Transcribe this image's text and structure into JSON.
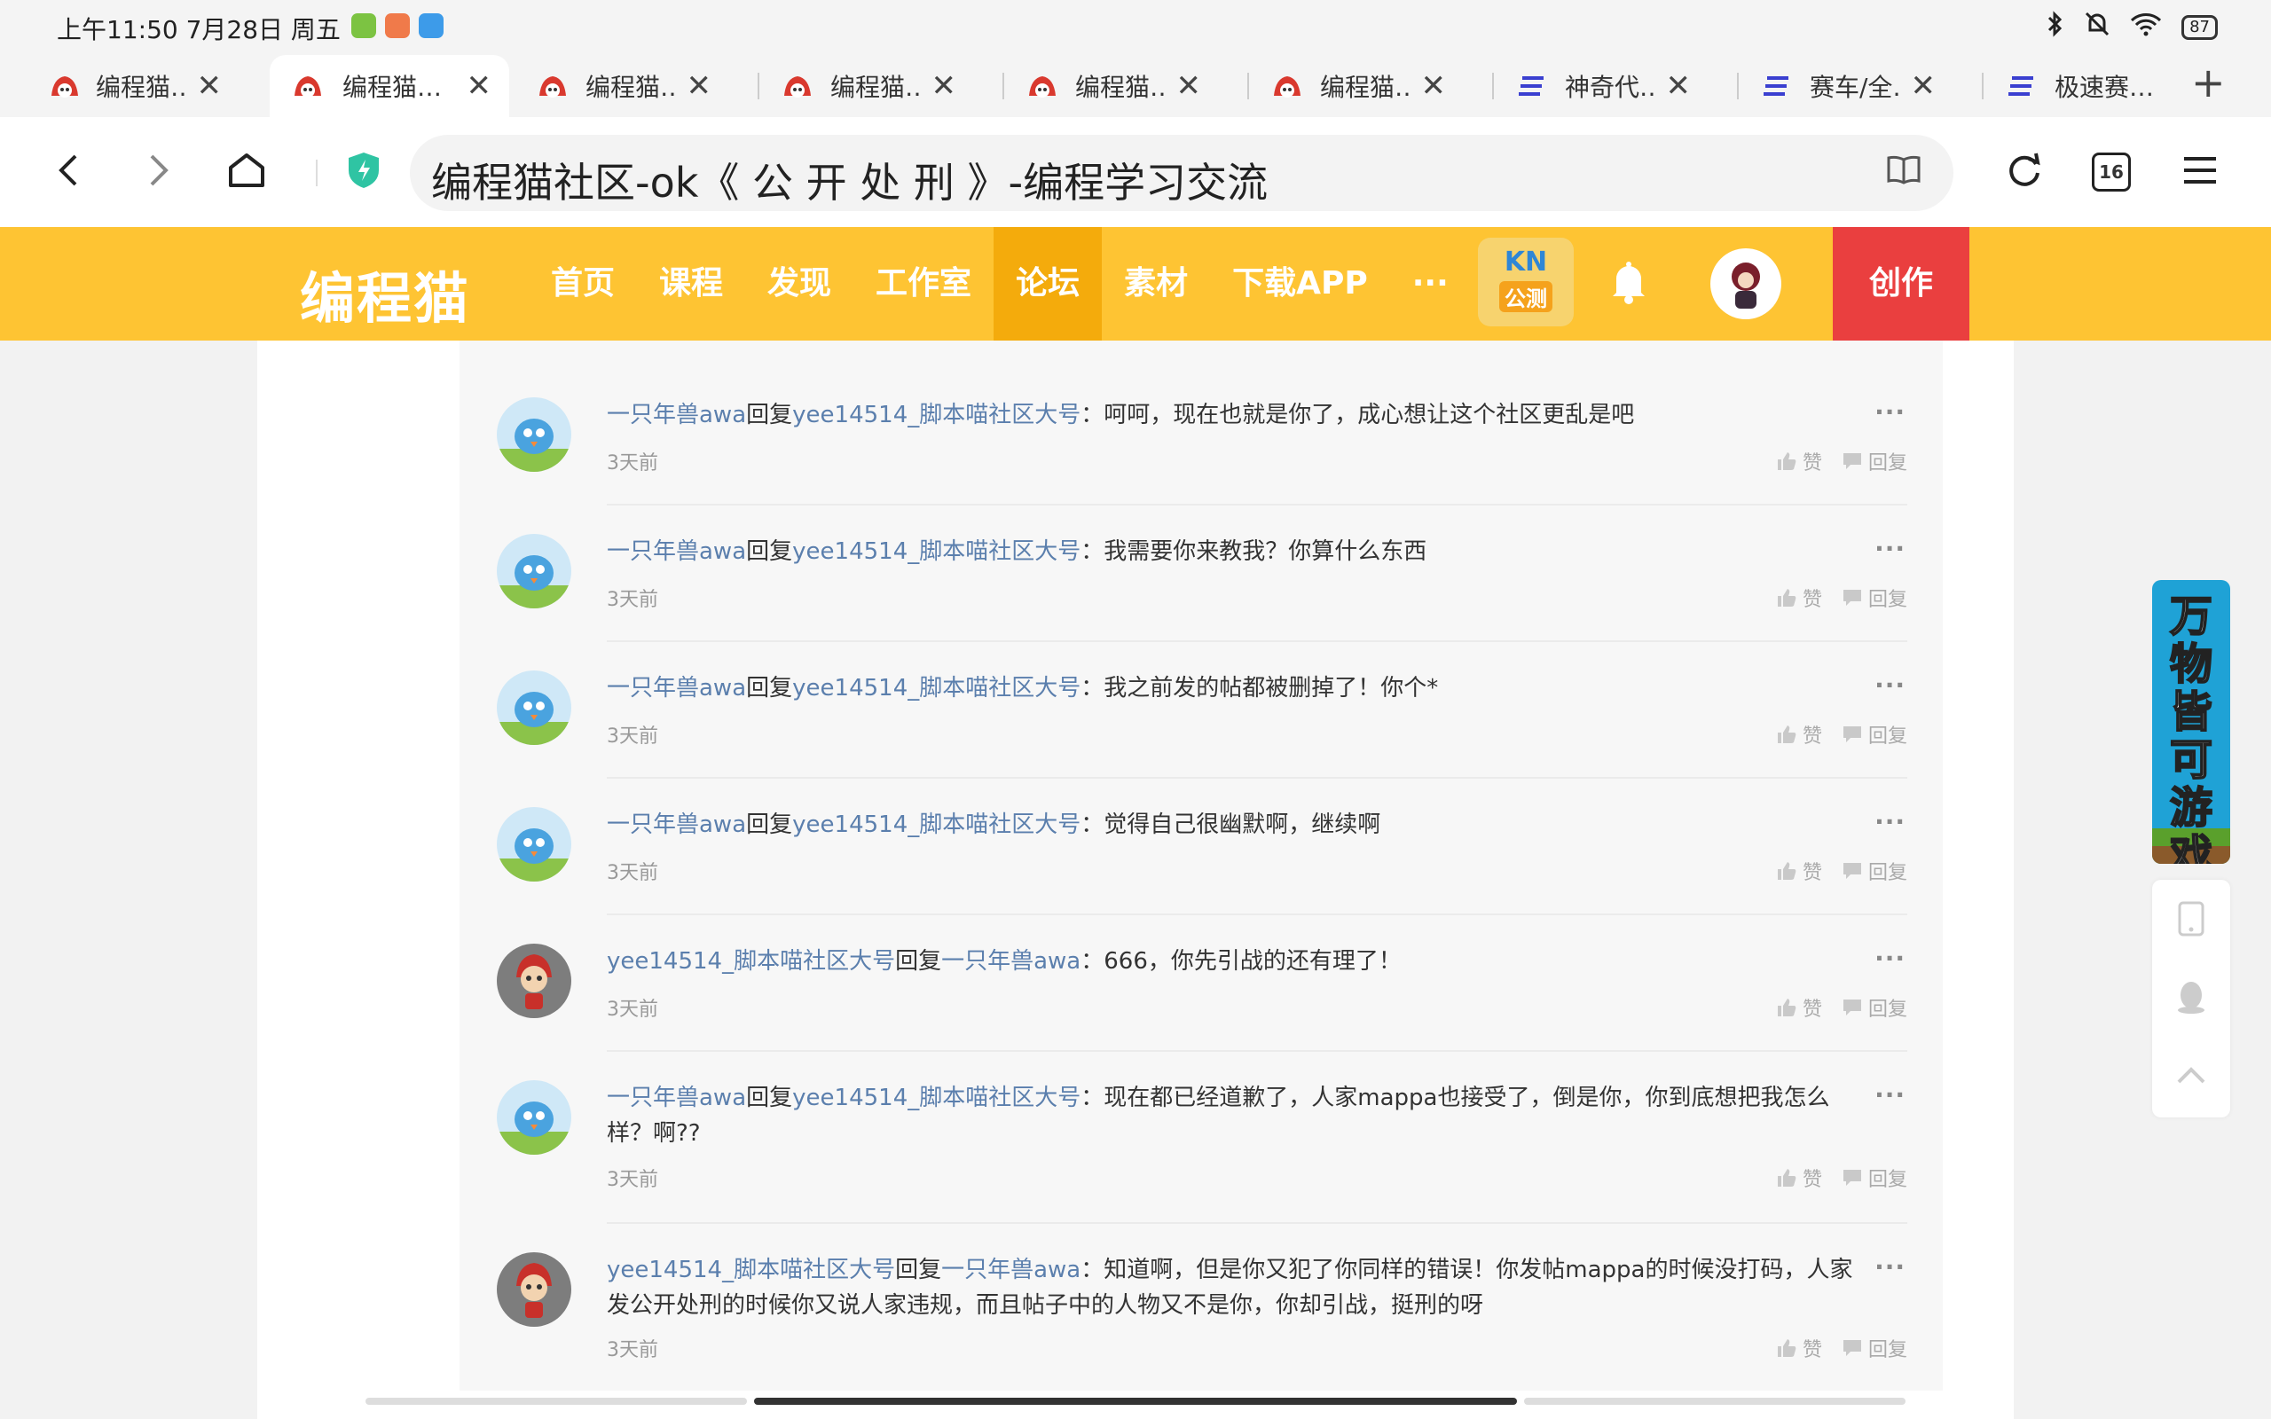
{
  "status_bar": {
    "time": "上午11:50 7月28日 周五",
    "battery": "87"
  },
  "tabs": [
    {
      "label": "编程猫…",
      "icon": "codemao-icon"
    },
    {
      "label": "编程猫…",
      "icon": "codemao-icon",
      "active": true
    },
    {
      "label": "编程猫…",
      "icon": "codemao-icon"
    },
    {
      "label": "编程猫…",
      "icon": "codemao-icon"
    },
    {
      "label": "编程猫…",
      "icon": "codemao-icon"
    },
    {
      "label": "编程猫…",
      "icon": "codemao-icon"
    },
    {
      "label": "神奇代…",
      "icon": "doc-icon"
    },
    {
      "label": "赛车/全…",
      "icon": "doc-icon"
    },
    {
      "label": "极速赛…",
      "icon": "doc-icon"
    }
  ],
  "address_bar": {
    "url_title": "编程猫社区-ok《 公 开 处 刑 》-编程学习交流",
    "tab_count": "16"
  },
  "site_header": {
    "logo": "编程猫",
    "nav": [
      "首页",
      "课程",
      "发现",
      "工作室",
      "论坛",
      "素材",
      "下载APP",
      "···"
    ],
    "active_nav": "论坛",
    "kn_top": "KN",
    "kn_bottom": "公测",
    "create": "创作",
    "brand_color": "#fec433",
    "create_color": "#ea3f3f"
  },
  "comments": [
    {
      "user": "一只年兽awa",
      "reply_word": "回复",
      "target": "yee14514_脚本喵社区大号",
      "text": "：呵呵，现在也就是你了，成心想让这个社区更乱是吧",
      "time": "3天前",
      "avatar": "bird-avatar"
    },
    {
      "user": "一只年兽awa",
      "reply_word": "回复",
      "target": "yee14514_脚本喵社区大号",
      "text": "：我需要你来教我？你算什么东西",
      "time": "3天前",
      "avatar": "bird-avatar"
    },
    {
      "user": "一只年兽awa",
      "reply_word": "回复",
      "target": "yee14514_脚本喵社区大号",
      "text": "：我之前发的帖都被删掉了！你个*",
      "time": "3天前",
      "avatar": "bird-avatar"
    },
    {
      "user": "一只年兽awa",
      "reply_word": "回复",
      "target": "yee14514_脚本喵社区大号",
      "text": "：觉得自己很幽默啊，继续啊",
      "time": "3天前",
      "avatar": "bird-avatar"
    },
    {
      "user": "yee14514_脚本喵社区大号",
      "reply_word": "回复",
      "target": "一只年兽awa",
      "text": "：666，你先引战的还有理了！",
      "time": "3天前",
      "avatar": "cat-avatar"
    },
    {
      "user": "一只年兽awa",
      "reply_word": "回复",
      "target": "yee14514_脚本喵社区大号",
      "text": "：现在都已经道歉了，人家mappa也接受了，倒是你，你到底想把我怎么样？啊??",
      "time": "3天前",
      "avatar": "bird-avatar"
    },
    {
      "user": "yee14514_脚本喵社区大号",
      "reply_word": "回复",
      "target": "一只年兽awa",
      "text": "：知道啊，但是你又犯了你同样的错误！你发帖mappa的时候没打码，人家发公开处刑的时候你又说人家违规，而且帖子中的人物又不是你，你却引战，挺刑的呀",
      "time": "3天前",
      "avatar": "cat-avatar"
    }
  ],
  "comment_actions": {
    "like": "赞",
    "reply": "回复",
    "more": "···"
  },
  "promo": {
    "text": "万物皆可游戏"
  }
}
